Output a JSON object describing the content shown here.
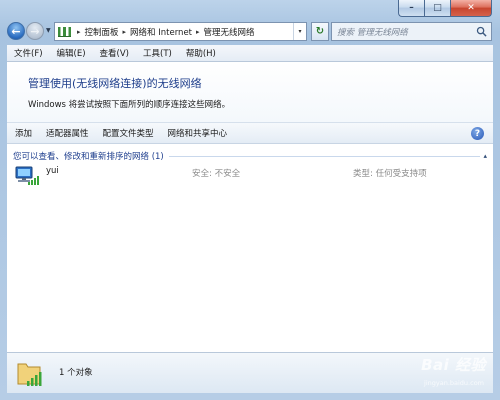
{
  "window": {
    "caption_buttons": {
      "minimize": "–",
      "maximize": "□",
      "close": "✕"
    }
  },
  "address_bar": {
    "crumbs": [
      "控制面板",
      "网络和 Internet",
      "管理无线网络"
    ],
    "separator": "▸",
    "dropdown": "▾"
  },
  "search": {
    "placeholder": "搜索 管理无线网络"
  },
  "menu": [
    "文件(F)",
    "编辑(E)",
    "查看(V)",
    "工具(T)",
    "帮助(H)"
  ],
  "header": {
    "title": "管理使用(无线网络连接)的无线网络",
    "description": "Windows 将尝试按照下面所列的顺序连接这些网络。"
  },
  "commands": [
    "添加",
    "适配器属性",
    "配置文件类型",
    "网络和共享中心"
  ],
  "help": "?",
  "group": {
    "label": "您可以查看、修改和重新排序的网络 (1)",
    "chevron": "▴"
  },
  "networks": [
    {
      "name": "yui",
      "security": "安全: 不安全",
      "type": "类型: 任何受支持项"
    }
  ],
  "status": {
    "count_text": "1 个对象"
  },
  "watermark": {
    "main": "Bai 经验",
    "sub": "jingyan.baidu.com"
  },
  "colors": {
    "title_blue": "#1e3e8b",
    "group_blue": "#1f3f8e",
    "muted_gray": "#8a8a8a",
    "frame_blue": "#a7c3e0"
  },
  "icons": {
    "back": "back-arrow-icon",
    "forward": "forward-arrow-icon",
    "refresh": "refresh-icon",
    "search": "search-icon",
    "help": "help-icon",
    "network": "wireless-network-icon"
  }
}
